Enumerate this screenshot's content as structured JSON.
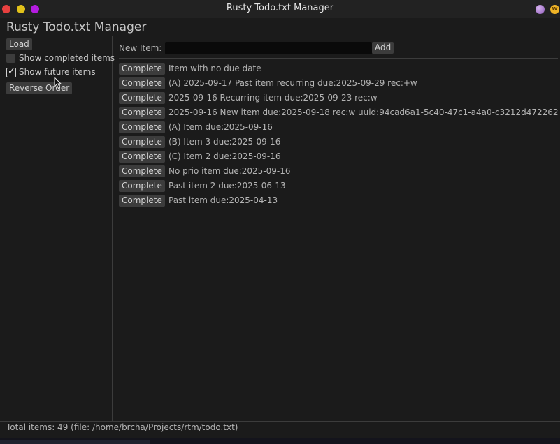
{
  "window": {
    "title": "Rusty Todo.txt Manager"
  },
  "app": {
    "title": "Rusty Todo.txt Manager"
  },
  "sidebar": {
    "load_label": "Load",
    "show_completed": {
      "label": "Show completed items",
      "checked": false
    },
    "show_future": {
      "label": "Show future items",
      "checked": true
    },
    "reverse_label": "Reverse Order"
  },
  "new_item": {
    "label": "New Item:",
    "value": "",
    "placeholder": "",
    "add_label": "Add"
  },
  "todos": [
    {
      "action": "Complete",
      "text": "Item with no due date"
    },
    {
      "action": "Complete",
      "text": "(A) 2025-09-17 Past item recurring due:2025-09-29 rec:+w"
    },
    {
      "action": "Complete",
      "text": "2025-09-16 Recurring item due:2025-09-23 rec:w"
    },
    {
      "action": "Complete",
      "text": "2025-09-16 New item due:2025-09-18 rec:w uuid:94cad6a1-5c40-47c1-a4a0-c3212d472262"
    },
    {
      "action": "Complete",
      "text": "(A) Item due:2025-09-16"
    },
    {
      "action": "Complete",
      "text": "(B) Item 3 due:2025-09-16"
    },
    {
      "action": "Complete",
      "text": "(C) Item 2 due:2025-09-16"
    },
    {
      "action": "Complete",
      "text": "No prio item due:2025-09-16"
    },
    {
      "action": "Complete",
      "text": "Past item 2 due:2025-06-13"
    },
    {
      "action": "Complete",
      "text": "Past item due:2025-04-13"
    }
  ],
  "status": {
    "text": "Total items: 49 (file: /home/brcha/Projects/rtm/todo.txt)"
  },
  "colors": {
    "background": "#1b1b1b",
    "button": "#3c3c3c",
    "input": "#0a0a0a",
    "close": "#e8403f",
    "minimize": "#e2c21a",
    "maximize": "#b51ce0"
  },
  "icons": {
    "close": "close-icon",
    "minimize": "minimize-icon",
    "maximize": "maximize-icon",
    "checkmark": "checkmark-icon",
    "cursor": "mouse-cursor-icon"
  }
}
